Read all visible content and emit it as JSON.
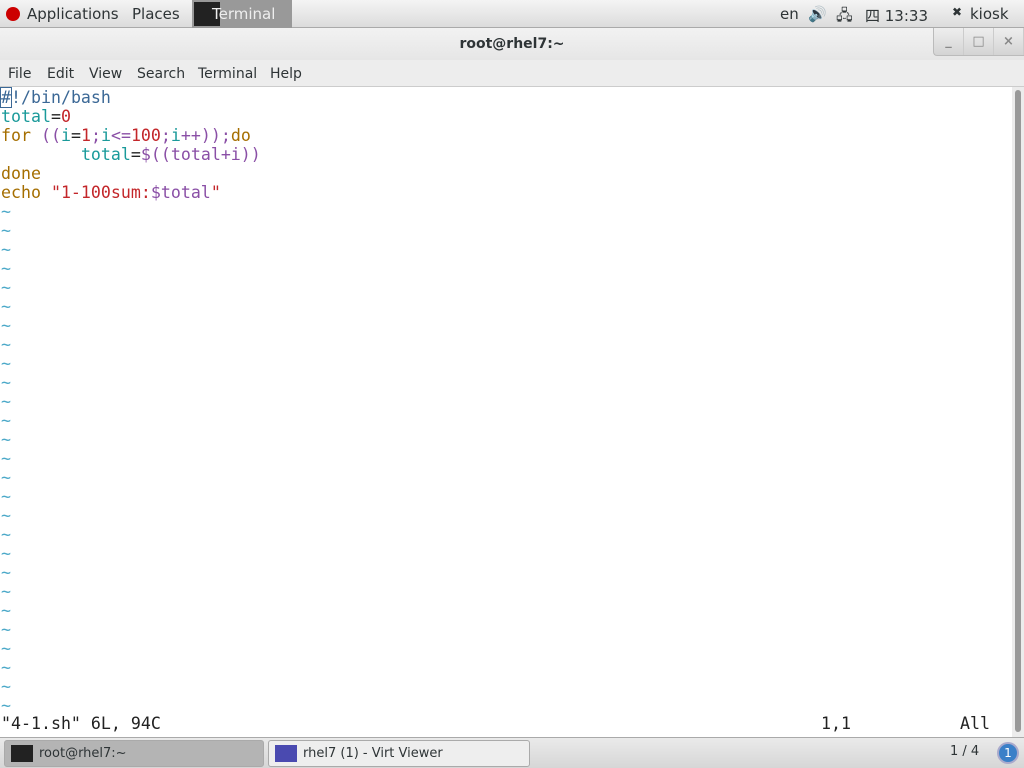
{
  "topbar": {
    "applications": "Applications",
    "places": "Places",
    "active_app": "Terminal",
    "lang": "en",
    "clock": "四 13:33",
    "user": "kiosk"
  },
  "window": {
    "title": "root@rhel7:~",
    "minimize": "_",
    "maximize": "□",
    "close": "×"
  },
  "menu": [
    "File",
    "Edit",
    "View",
    "Search",
    "Terminal",
    "Help"
  ],
  "editor": {
    "lines": [
      [
        {
          "c": "b",
          "t": "#"
        },
        {
          "c": "b",
          "t": "!/bin/bash"
        }
      ],
      [
        {
          "c": "t",
          "t": "total"
        },
        {
          "c": "k",
          "t": "="
        },
        {
          "c": "r",
          "t": "0"
        }
      ],
      [
        {
          "c": "o",
          "t": "for "
        },
        {
          "c": "p",
          "t": "(("
        },
        {
          "c": "t",
          "t": "i"
        },
        {
          "c": "k",
          "t": "="
        },
        {
          "c": "r",
          "t": "1"
        },
        {
          "c": "p",
          "t": ";"
        },
        {
          "c": "t",
          "t": "i"
        },
        {
          "c": "p",
          "t": "<="
        },
        {
          "c": "r",
          "t": "100"
        },
        {
          "c": "p",
          "t": ";"
        },
        {
          "c": "t",
          "t": "i"
        },
        {
          "c": "p",
          "t": "++));"
        },
        {
          "c": "o",
          "t": "do"
        }
      ],
      [
        {
          "c": "k",
          "t": "        "
        },
        {
          "c": "t",
          "t": "total"
        },
        {
          "c": "k",
          "t": "="
        },
        {
          "c": "p",
          "t": "$((total+i))"
        }
      ],
      [
        {
          "c": "o",
          "t": "done"
        }
      ],
      [
        {
          "c": "o",
          "t": "echo "
        },
        {
          "c": "r",
          "t": "\"1-100sum:"
        },
        {
          "c": "p",
          "t": "$total"
        },
        {
          "c": "r",
          "t": "\""
        }
      ]
    ],
    "tilde": "~",
    "status_file": "\"4-1.sh\" 6L, 94C",
    "status_pos": "1,1",
    "status_all": "All"
  },
  "taskbar": {
    "tasks": [
      "root@rhel7:~",
      "rhel7 (1) - Virt Viewer"
    ],
    "workspace": "1 / 4",
    "workspace_num": "1"
  }
}
